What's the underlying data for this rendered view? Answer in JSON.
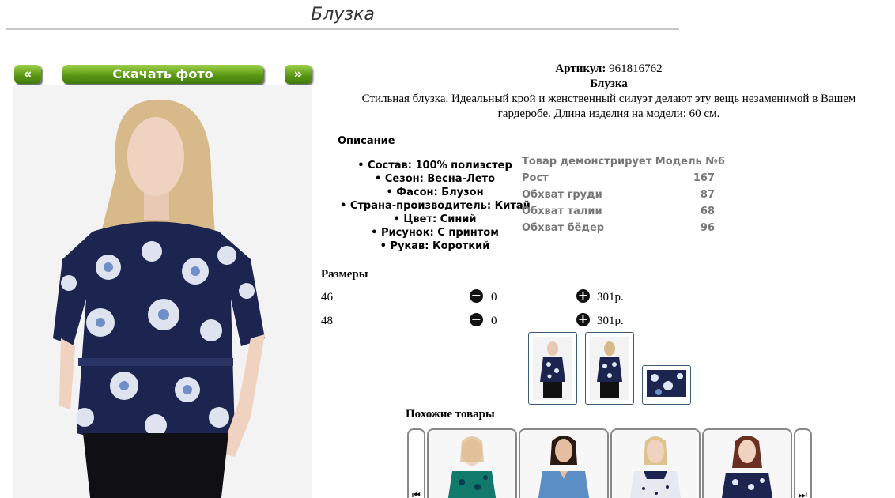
{
  "page": {
    "title": "Блузка"
  },
  "gallery": {
    "prev_label": "«",
    "download_label": "Скачать фото",
    "next_label": "»"
  },
  "product": {
    "article_label": "Артикул:",
    "article_value": "961816762",
    "name": "Блузка",
    "description_line1": "Стильная блузка. Идеальный крой и женственный силуэт делают эту вещь незаменимой в Вашем",
    "description_line2": "гардеробе. Длина изделия на модели: 60 см."
  },
  "description": {
    "title": "Описание",
    "properties": [
      "Состав: 100% полиэстер",
      "Сезон: Весна-Лето",
      "Фасон: Блузон",
      "Страна-производитель: Китай",
      "Цвет: Синий",
      "Рисунок: С принтом",
      "Рукав: Короткий"
    ]
  },
  "model": {
    "heading": "Товар демонстрирует Модель №6",
    "rows": [
      {
        "label": "Рост",
        "value": "167"
      },
      {
        "label": "Обхват груди",
        "value": "87"
      },
      {
        "label": "Обхват талии",
        "value": "68"
      },
      {
        "label": "Обхват бёдер",
        "value": "96"
      }
    ]
  },
  "sizes": {
    "title": "Размеры",
    "rows": [
      {
        "size": "46",
        "qty": "0",
        "price": "301р."
      },
      {
        "size": "48",
        "qty": "0",
        "price": "301р."
      }
    ]
  },
  "similar": {
    "title": "Похожие товары",
    "prev_icon": "⏮",
    "next_icon": "⏭"
  },
  "icons": {
    "minus": "minus-circle-icon",
    "plus": "plus-circle-icon"
  },
  "colors": {
    "button_green": "#5c9a14",
    "print_navy": "#1b2550",
    "print_blue": "#6f8fc8"
  }
}
